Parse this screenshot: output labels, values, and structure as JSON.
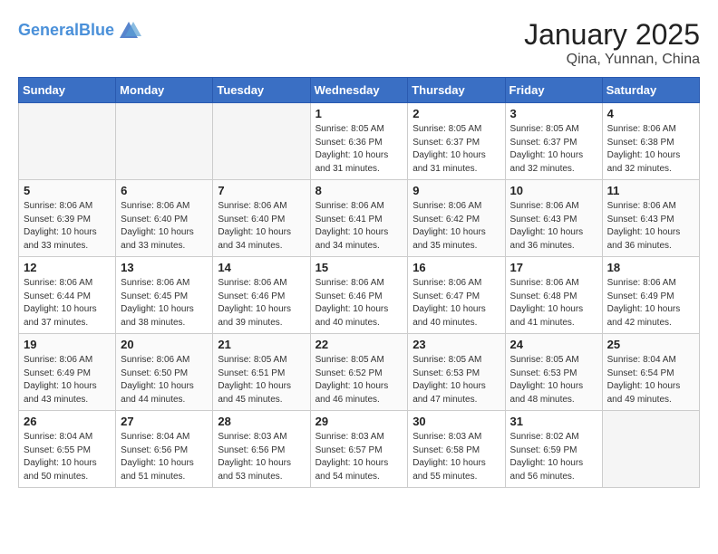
{
  "header": {
    "logo_line1": "General",
    "logo_line2": "Blue",
    "title": "January 2025",
    "location": "Qina, Yunnan, China"
  },
  "days_of_week": [
    "Sunday",
    "Monday",
    "Tuesday",
    "Wednesday",
    "Thursday",
    "Friday",
    "Saturday"
  ],
  "weeks": [
    [
      {
        "day": "",
        "info": ""
      },
      {
        "day": "",
        "info": ""
      },
      {
        "day": "",
        "info": ""
      },
      {
        "day": "1",
        "info": "Sunrise: 8:05 AM\nSunset: 6:36 PM\nDaylight: 10 hours\nand 31 minutes."
      },
      {
        "day": "2",
        "info": "Sunrise: 8:05 AM\nSunset: 6:37 PM\nDaylight: 10 hours\nand 31 minutes."
      },
      {
        "day": "3",
        "info": "Sunrise: 8:05 AM\nSunset: 6:37 PM\nDaylight: 10 hours\nand 32 minutes."
      },
      {
        "day": "4",
        "info": "Sunrise: 8:06 AM\nSunset: 6:38 PM\nDaylight: 10 hours\nand 32 minutes."
      }
    ],
    [
      {
        "day": "5",
        "info": "Sunrise: 8:06 AM\nSunset: 6:39 PM\nDaylight: 10 hours\nand 33 minutes."
      },
      {
        "day": "6",
        "info": "Sunrise: 8:06 AM\nSunset: 6:40 PM\nDaylight: 10 hours\nand 33 minutes."
      },
      {
        "day": "7",
        "info": "Sunrise: 8:06 AM\nSunset: 6:40 PM\nDaylight: 10 hours\nand 34 minutes."
      },
      {
        "day": "8",
        "info": "Sunrise: 8:06 AM\nSunset: 6:41 PM\nDaylight: 10 hours\nand 34 minutes."
      },
      {
        "day": "9",
        "info": "Sunrise: 8:06 AM\nSunset: 6:42 PM\nDaylight: 10 hours\nand 35 minutes."
      },
      {
        "day": "10",
        "info": "Sunrise: 8:06 AM\nSunset: 6:43 PM\nDaylight: 10 hours\nand 36 minutes."
      },
      {
        "day": "11",
        "info": "Sunrise: 8:06 AM\nSunset: 6:43 PM\nDaylight: 10 hours\nand 36 minutes."
      }
    ],
    [
      {
        "day": "12",
        "info": "Sunrise: 8:06 AM\nSunset: 6:44 PM\nDaylight: 10 hours\nand 37 minutes."
      },
      {
        "day": "13",
        "info": "Sunrise: 8:06 AM\nSunset: 6:45 PM\nDaylight: 10 hours\nand 38 minutes."
      },
      {
        "day": "14",
        "info": "Sunrise: 8:06 AM\nSunset: 6:46 PM\nDaylight: 10 hours\nand 39 minutes."
      },
      {
        "day": "15",
        "info": "Sunrise: 8:06 AM\nSunset: 6:46 PM\nDaylight: 10 hours\nand 40 minutes."
      },
      {
        "day": "16",
        "info": "Sunrise: 8:06 AM\nSunset: 6:47 PM\nDaylight: 10 hours\nand 40 minutes."
      },
      {
        "day": "17",
        "info": "Sunrise: 8:06 AM\nSunset: 6:48 PM\nDaylight: 10 hours\nand 41 minutes."
      },
      {
        "day": "18",
        "info": "Sunrise: 8:06 AM\nSunset: 6:49 PM\nDaylight: 10 hours\nand 42 minutes."
      }
    ],
    [
      {
        "day": "19",
        "info": "Sunrise: 8:06 AM\nSunset: 6:49 PM\nDaylight: 10 hours\nand 43 minutes."
      },
      {
        "day": "20",
        "info": "Sunrise: 8:06 AM\nSunset: 6:50 PM\nDaylight: 10 hours\nand 44 minutes."
      },
      {
        "day": "21",
        "info": "Sunrise: 8:05 AM\nSunset: 6:51 PM\nDaylight: 10 hours\nand 45 minutes."
      },
      {
        "day": "22",
        "info": "Sunrise: 8:05 AM\nSunset: 6:52 PM\nDaylight: 10 hours\nand 46 minutes."
      },
      {
        "day": "23",
        "info": "Sunrise: 8:05 AM\nSunset: 6:53 PM\nDaylight: 10 hours\nand 47 minutes."
      },
      {
        "day": "24",
        "info": "Sunrise: 8:05 AM\nSunset: 6:53 PM\nDaylight: 10 hours\nand 48 minutes."
      },
      {
        "day": "25",
        "info": "Sunrise: 8:04 AM\nSunset: 6:54 PM\nDaylight: 10 hours\nand 49 minutes."
      }
    ],
    [
      {
        "day": "26",
        "info": "Sunrise: 8:04 AM\nSunset: 6:55 PM\nDaylight: 10 hours\nand 50 minutes."
      },
      {
        "day": "27",
        "info": "Sunrise: 8:04 AM\nSunset: 6:56 PM\nDaylight: 10 hours\nand 51 minutes."
      },
      {
        "day": "28",
        "info": "Sunrise: 8:03 AM\nSunset: 6:56 PM\nDaylight: 10 hours\nand 53 minutes."
      },
      {
        "day": "29",
        "info": "Sunrise: 8:03 AM\nSunset: 6:57 PM\nDaylight: 10 hours\nand 54 minutes."
      },
      {
        "day": "30",
        "info": "Sunrise: 8:03 AM\nSunset: 6:58 PM\nDaylight: 10 hours\nand 55 minutes."
      },
      {
        "day": "31",
        "info": "Sunrise: 8:02 AM\nSunset: 6:59 PM\nDaylight: 10 hours\nand 56 minutes."
      },
      {
        "day": "",
        "info": ""
      }
    ]
  ]
}
